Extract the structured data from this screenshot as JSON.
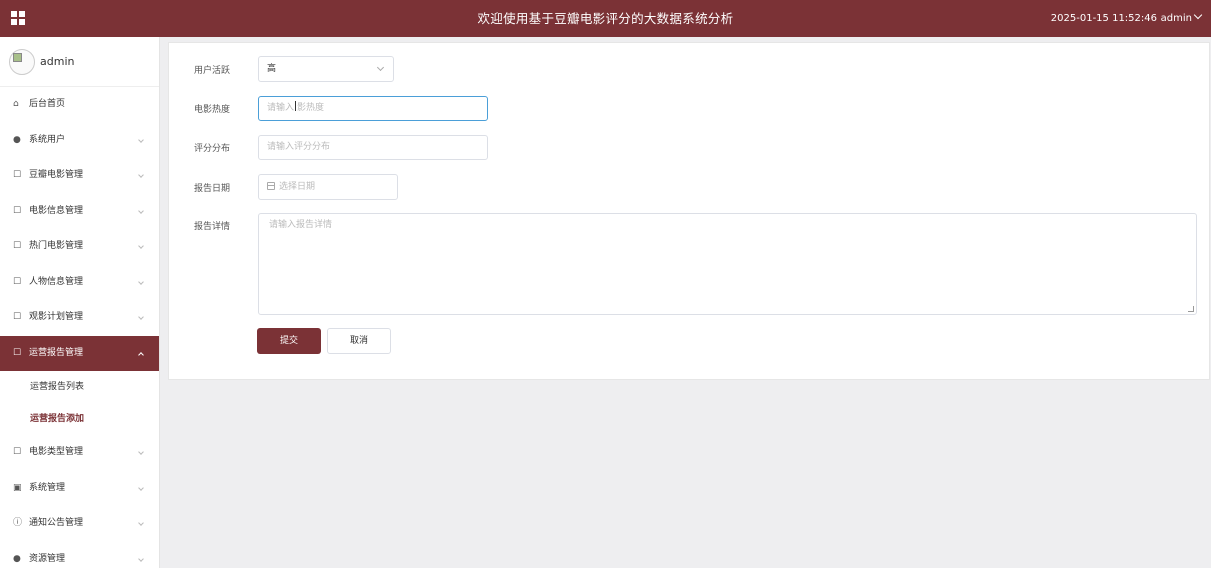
{
  "header": {
    "title": "欢迎使用基于豆瓣电影评分的大数据系统分析",
    "datetime": "2025-01-15 11:52:46",
    "user": "admin"
  },
  "sidebar": {
    "username": "admin",
    "items": [
      {
        "label": "后台首页",
        "icon": "home-icon"
      },
      {
        "label": "系统用户",
        "icon": "user-icon"
      },
      {
        "label": "豆瓣电影管理",
        "icon": "folder-icon"
      },
      {
        "label": "电影信息管理",
        "icon": "folder-icon"
      },
      {
        "label": "热门电影管理",
        "icon": "folder-icon"
      },
      {
        "label": "人物信息管理",
        "icon": "folder-icon"
      },
      {
        "label": "观影计划管理",
        "icon": "folder-icon"
      },
      {
        "label": "运营报告管理",
        "icon": "folder-icon"
      },
      {
        "label": "电影类型管理",
        "icon": "folder-icon"
      },
      {
        "label": "系统管理",
        "icon": "image-icon"
      },
      {
        "label": "通知公告管理",
        "icon": "info-icon"
      },
      {
        "label": "资源管理",
        "icon": "bulb-icon"
      }
    ],
    "subitems": [
      "运营报告列表",
      "运营报告添加"
    ]
  },
  "form": {
    "activity_label": "用户活跃",
    "activity_value": "高",
    "heat_label": "电影热度",
    "heat_placeholder_a": "请输入",
    "heat_placeholder_b": "影热度",
    "score_label": "评分分布",
    "score_placeholder": "请输入评分分布",
    "date_label": "报告日期",
    "date_placeholder": "选择日期",
    "details_label": "报告详情",
    "details_placeholder": "请输入报告详情",
    "submit_label": "提交",
    "cancel_label": "取消"
  },
  "colors": {
    "brand": "#7b3236",
    "focus": "#4b9fd8"
  }
}
